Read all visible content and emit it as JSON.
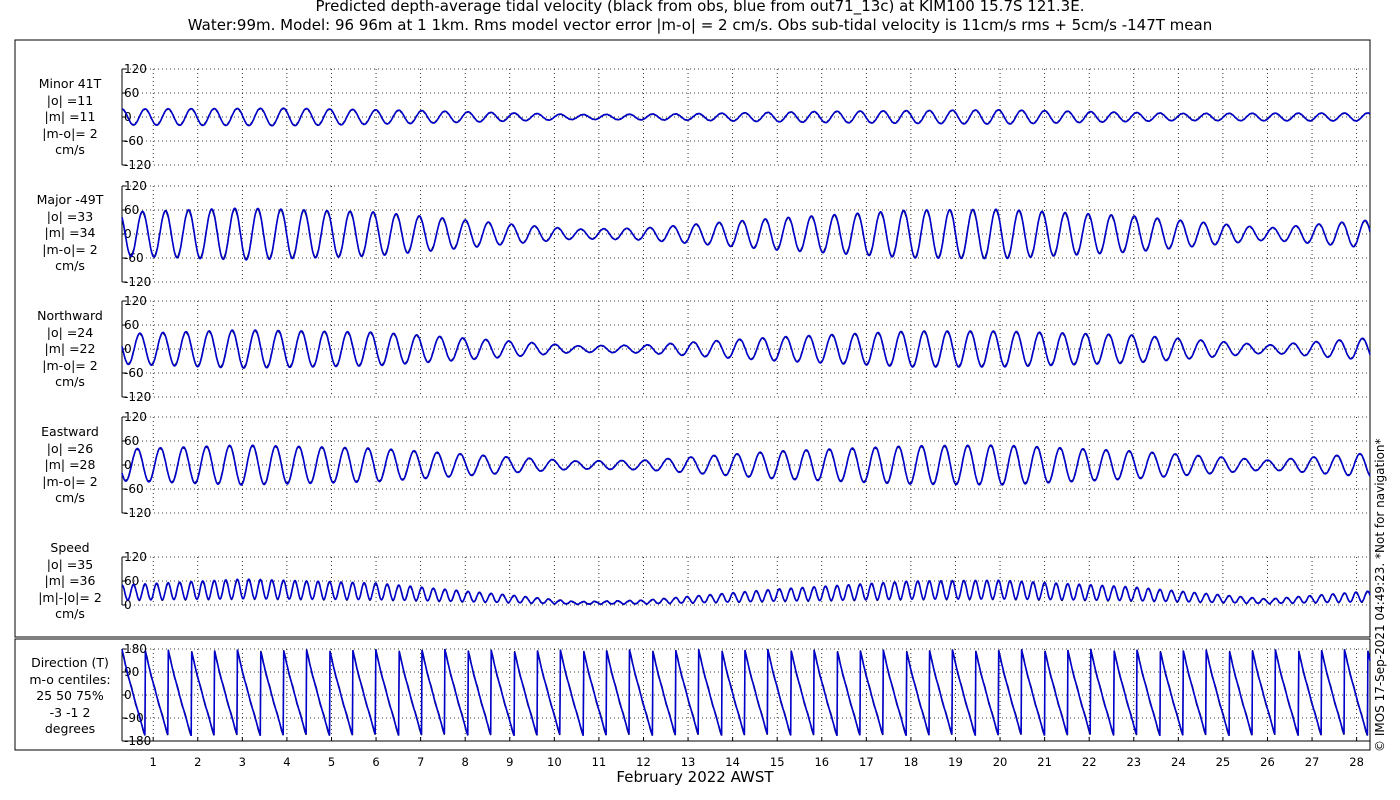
{
  "title": {
    "line1": "Predicted depth-average tidal velocity (black from obs, blue from out71_13c) at KIM100 15.7S 121.3E.",
    "line2": "Water:99m. Model: 96 96m at 1 1km. Rms model vector error |m-o| = 2 cm/s. Obs sub-tidal velocity is 11cm/s rms + 5cm/s -147T mean"
  },
  "xlabel": "February 2022 AWST",
  "credit": "© IMOS 17-Sep-2021 04:49:23. *Not for navigation*",
  "colors": {
    "obs": "#000000",
    "model": "#0000cc",
    "grid": "#000000"
  },
  "chart_data": [
    {
      "type": "line",
      "label_lines": [
        "Minor 41T",
        "|o| =11",
        "|m| =11",
        "|m-o|= 2",
        "cm/s"
      ],
      "ylim": [
        -120,
        120
      ],
      "yticks": [
        -120,
        -60,
        0,
        60,
        120
      ],
      "x": [
        0.3,
        28.3
      ],
      "amplitude_envelope": {
        "day": [
          0.3,
          4,
          7,
          10.5,
          13,
          16,
          20,
          24,
          28.3
        ],
        "amp": [
          20,
          22,
          16,
          6,
          8,
          14,
          18,
          9,
          10
        ]
      },
      "series": [
        {
          "name": "obs"
        },
        {
          "name": "model"
        }
      ]
    },
    {
      "type": "line",
      "label_lines": [
        "Major -49T",
        "|o| =33",
        "|m| =34",
        "|m-o|= 2",
        "cm/s"
      ],
      "ylim": [
        -120,
        120
      ],
      "yticks": [
        -120,
        -60,
        0,
        60,
        120
      ],
      "x": [
        0.3,
        28.3
      ],
      "amplitude_envelope": {
        "day": [
          0.3,
          3,
          6,
          9,
          10.5,
          12,
          15,
          18,
          20,
          23,
          26,
          28.3
        ],
        "amp": [
          55,
          65,
          55,
          25,
          12,
          15,
          40,
          60,
          62,
          45,
          15,
          35
        ]
      },
      "series": [
        {
          "name": "obs"
        },
        {
          "name": "model"
        }
      ]
    },
    {
      "type": "line",
      "label_lines": [
        "Northward",
        "|o| =24",
        "|m| =22",
        "|m-o|= 2",
        "cm/s"
      ],
      "ylim": [
        -120,
        120
      ],
      "yticks": [
        -120,
        -60,
        0,
        60,
        120
      ],
      "x": [
        0.3,
        28.3
      ],
      "amplitude_envelope": {
        "day": [
          0.3,
          3,
          6,
          9,
          10.5,
          12,
          15,
          18,
          20,
          23,
          26,
          28.3
        ],
        "amp": [
          38,
          48,
          42,
          20,
          8,
          10,
          30,
          45,
          45,
          35,
          10,
          28
        ]
      },
      "series": [
        {
          "name": "obs"
        },
        {
          "name": "model"
        }
      ]
    },
    {
      "type": "line",
      "label_lines": [
        "Eastward",
        "|o| =26",
        "|m| =28",
        "|m-o|= 2",
        "cm/s"
      ],
      "ylim": [
        -120,
        120
      ],
      "yticks": [
        -120,
        -60,
        0,
        60,
        120
      ],
      "x": [
        0.3,
        28.3
      ],
      "amplitude_envelope": {
        "day": [
          0.3,
          3,
          6,
          9,
          10.5,
          12,
          15,
          18,
          20,
          23,
          26,
          28.3
        ],
        "amp": [
          40,
          50,
          42,
          20,
          10,
          12,
          35,
          48,
          50,
          35,
          12,
          30
        ]
      },
      "series": [
        {
          "name": "obs"
        },
        {
          "name": "model"
        }
      ]
    },
    {
      "type": "line",
      "label_lines": [
        "Speed",
        "|o| =35",
        "|m| =36",
        "|m|-|o|= 2",
        "cm/s"
      ],
      "ylim": [
        0,
        120
      ],
      "yticks": [
        0,
        60,
        120
      ],
      "x": [
        0.3,
        28.3
      ],
      "amplitude_envelope": {
        "day": [
          0.3,
          3,
          6,
          9,
          10.5,
          12,
          15,
          18,
          20,
          23,
          26,
          28.3
        ],
        "amp": [
          50,
          65,
          55,
          25,
          8,
          12,
          40,
          60,
          62,
          45,
          15,
          35
        ]
      },
      "series": [
        {
          "name": "obs"
        },
        {
          "name": "model"
        }
      ]
    },
    {
      "type": "line",
      "label_lines": [
        "Direction (T)",
        "m-o centiles:",
        "25  50  75%",
        "-3 -1  2",
        "degrees"
      ],
      "ylim": [
        -180,
        180
      ],
      "yticks": [
        -180,
        -90,
        0,
        90,
        180
      ],
      "xticks": [
        1,
        2,
        3,
        4,
        5,
        6,
        7,
        8,
        9,
        10,
        11,
        12,
        13,
        14,
        15,
        16,
        17,
        18,
        19,
        20,
        21,
        22,
        23,
        24,
        25,
        26,
        27,
        28
      ],
      "x": [
        0.3,
        28.3
      ],
      "series": [
        {
          "name": "obs"
        },
        {
          "name": "model"
        }
      ]
    }
  ]
}
